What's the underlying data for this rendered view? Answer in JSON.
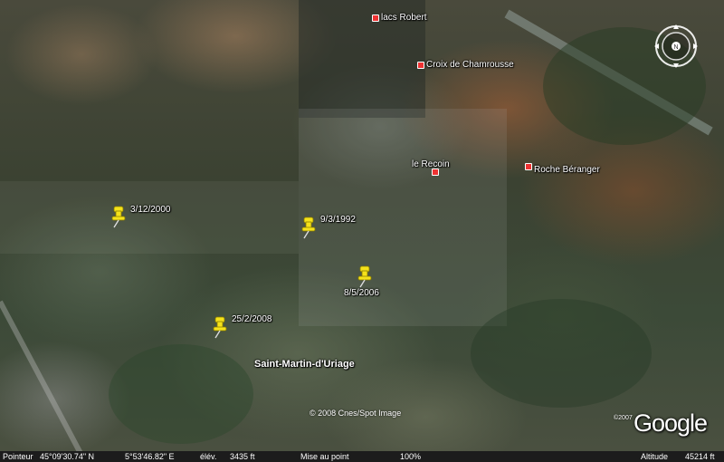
{
  "places": [
    {
      "name": "lacs Robert"
    },
    {
      "name": "Croix de Chamrousse"
    },
    {
      "name": "le Recoin"
    },
    {
      "name": "Roche Béranger"
    }
  ],
  "town": "Saint-Martin-d'Uriage",
  "pins": [
    {
      "label": "3/12/2000"
    },
    {
      "label": "9/3/1992"
    },
    {
      "label": "8/5/2006"
    },
    {
      "label": "25/2/2008"
    }
  ],
  "copyright": "© 2008 Cnes/Spot Image",
  "logo": {
    "year": "©2007",
    "text": "Google"
  },
  "compass_icon": "compass-icon",
  "pin_icon": "pushpin-icon",
  "colors": {
    "pin": "#f5e21a",
    "place_marker": "#e33333"
  },
  "statusbar": {
    "pointer_label": "Pointeur",
    "lat": "45°09'30.74\" N",
    "lon": "5°53'46.82\" E",
    "elev_label": "élév.",
    "elev": "3435 ft",
    "focus_label": "Mise au point",
    "focus_value": "100%",
    "alt_label": "Altitude",
    "alt_value": "45214 ft"
  }
}
